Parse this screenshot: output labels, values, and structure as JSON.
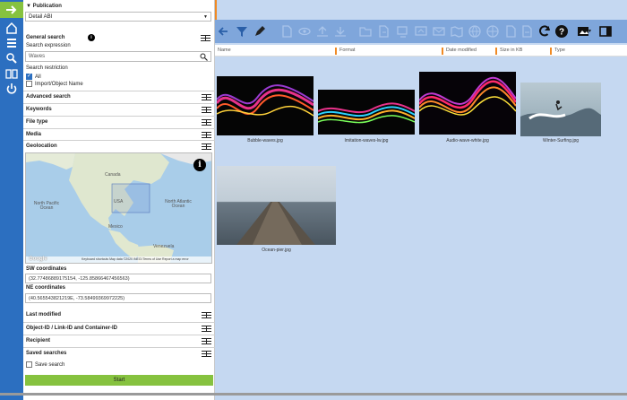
{
  "rail": {
    "items": [
      {
        "icon": "arrow-right-icon",
        "active": true
      },
      {
        "icon": "home-icon"
      },
      {
        "icon": "menu-icon"
      },
      {
        "icon": "search-icon"
      },
      {
        "icon": "book-icon"
      },
      {
        "icon": "power-icon"
      }
    ]
  },
  "panel": {
    "publication_label": "Publication",
    "publication_value": "Detail ABI",
    "general_search_title": "General search",
    "search_expression_label": "Search expression",
    "search_expression_value": "Waves",
    "search_restriction_label": "Search restriction",
    "restrictions": [
      {
        "label": "All",
        "checked": true
      },
      {
        "label": "Import/Object Name",
        "checked": false
      }
    ],
    "sections_top": [
      "Advanced search",
      "Keywords",
      "File type",
      "Media",
      "Geolocation"
    ],
    "map": {
      "labels": {
        "canada": "Canada",
        "north_atlantic": "North Atlantic Ocean",
        "north_pacific": "North Pacific Ocean",
        "usa": "USA",
        "mexico": "Mexico",
        "venezuela": "Venezuela"
      },
      "google": "Google",
      "footer": "Keyboard shortcuts   Map data ©2020 INEGI   Terms of Use   Report a map error"
    },
    "sw_label": "SW coordinates",
    "sw_value": "(32.77486889175154, -125.85866467456563)",
    "ne_label": "NE coordinates",
    "ne_value": "(40.565543821219E, -73.58499369972225)",
    "sections_bottom": [
      "Last modified",
      "Object-ID / Link-ID and Container-ID",
      "Recipient",
      "Saved searches"
    ],
    "save_search_label": "Save search",
    "start_label": "Start"
  },
  "main": {
    "columns": [
      "Name",
      "Format",
      "Date modified",
      "Size in KB",
      "Type"
    ],
    "toolbar_icons": [
      "arrow-back-icon",
      "filter-icon",
      "edit-icon",
      "document-icon",
      "eye-icon",
      "upload-icon",
      "download-icon",
      "folder-icon",
      "file-icon",
      "export-icon",
      "import-icon",
      "email-icon",
      "map-icon",
      "globe-icon",
      "share-icon",
      "page-icon",
      "copy-icon",
      "refresh-icon",
      "help-icon",
      "image-icon",
      "window-icon"
    ],
    "thumbs": [
      {
        "caption": "Bubble-waves.jpg"
      },
      {
        "caption": "Imitation-waves-lw.jpg"
      },
      {
        "caption": "Audio-wave-white.jpg"
      },
      {
        "caption": "Winter-Surfing.jpg"
      },
      {
        "caption": "Ocean-pier.jpg"
      }
    ]
  }
}
